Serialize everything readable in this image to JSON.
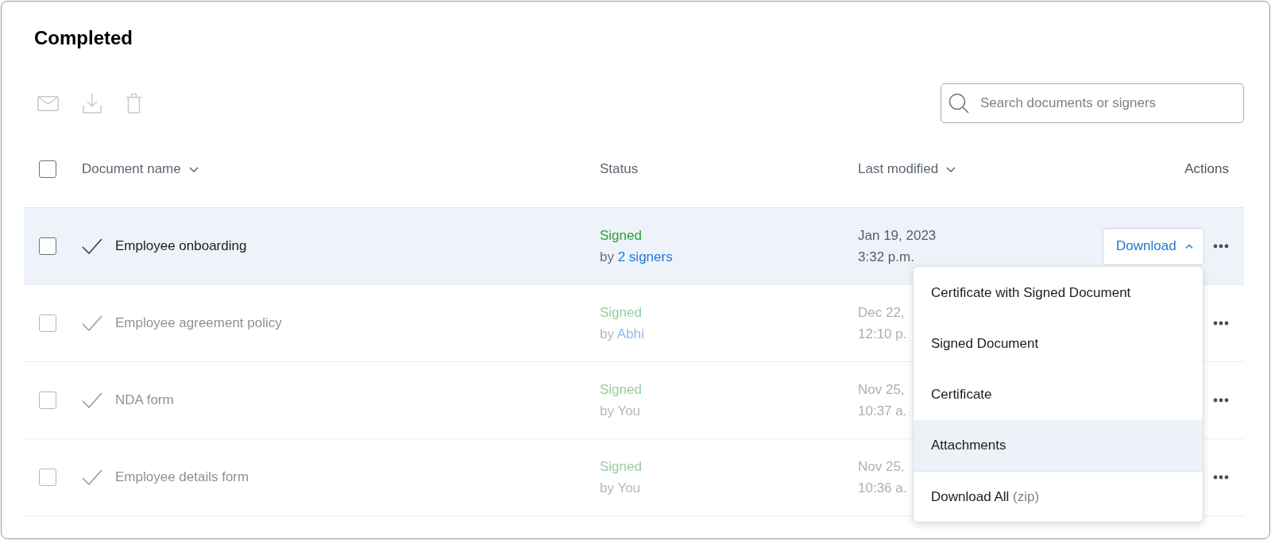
{
  "page": {
    "title": "Completed"
  },
  "toolbar": {
    "tools": [
      {
        "kind": "mail",
        "disabled": true
      },
      {
        "kind": "download",
        "disabled": true
      },
      {
        "kind": "trash",
        "disabled": true
      }
    ],
    "search": {
      "placeholder": "Search documents or signers"
    }
  },
  "table": {
    "select_all": {
      "checked": false
    },
    "columns": [
      {
        "label": "Document name",
        "sortable": true
      },
      {
        "label": "Status",
        "sortable": false
      },
      {
        "label": "Last modified",
        "sortable": true
      },
      {
        "label": "Actions",
        "sortable": false
      }
    ],
    "rows": [
      {
        "name": "Employee onboarding",
        "status": "Signed",
        "by": "by",
        "signer": "2 signers",
        "signer_link": true,
        "date": "Jan 19, 2023",
        "time": "3:32 p.m.",
        "checked": false,
        "highlighted": true,
        "disabled": false,
        "download": {
          "label": "Download",
          "expanded": true,
          "menu": [
            {
              "label": "Certificate with Signed Document",
              "highlighted": false,
              "separated": false
            },
            {
              "label": "Signed Document",
              "highlighted": false,
              "separated": false
            },
            {
              "label": "Certificate",
              "highlighted": false,
              "separated": false
            },
            {
              "label": "Attachments",
              "highlighted": true,
              "separated": false
            },
            {
              "label": "Download All",
              "note": "(zip)",
              "highlighted": false,
              "separated": true
            }
          ]
        }
      },
      {
        "name": "Employee agreement policy",
        "status": "Signed",
        "by": "by",
        "signer": "Abhi",
        "signer_link": true,
        "date": "Dec 22,",
        "time": "12:10 p.",
        "checked": false,
        "highlighted": false,
        "disabled": true
      },
      {
        "name": "NDA form",
        "status": "Signed",
        "by": "by",
        "signer": "You",
        "signer_link": false,
        "date": "Nov 25,",
        "time": "10:37 a.",
        "checked": false,
        "highlighted": false,
        "disabled": true
      },
      {
        "name": "Employee details form",
        "status": "Signed",
        "by": "by",
        "signer": "You",
        "signer_link": false,
        "date": "Nov 25,",
        "time": "10:36 a.",
        "checked": false,
        "highlighted": false,
        "disabled": true
      }
    ]
  }
}
